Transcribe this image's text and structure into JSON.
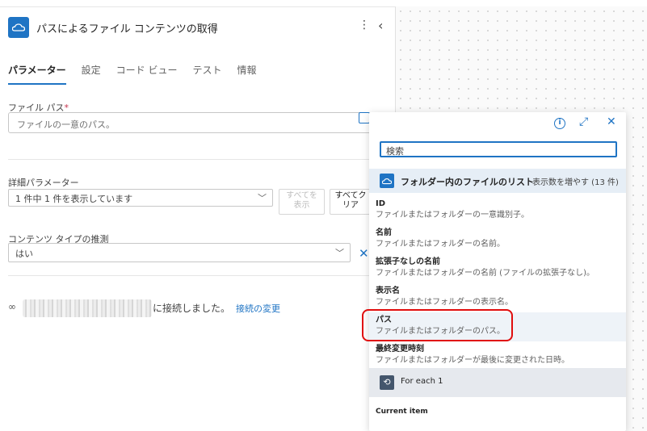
{
  "panel": {
    "title": "パスによるファイル コンテンツの取得",
    "tabs": [
      "パラメーター",
      "設定",
      "コード ビュー",
      "テスト",
      "情報"
    ],
    "file_path": {
      "label": "ファイル パス",
      "required_mark": "*",
      "placeholder": "ファイルの一意のパス。"
    },
    "advanced": {
      "label": "詳細パラメーター",
      "selected": "1 件中 1 件を表示しています",
      "show_all_label": "すべてを\n表示",
      "clear_all_label": "すべてク\nリア"
    },
    "content_type": {
      "label": "コンテンツ タイプの推測",
      "value": "はい"
    },
    "connection": {
      "text": "に接続しました。",
      "change_link": "接続の変更"
    }
  },
  "popup": {
    "search_placeholder": "検索",
    "section": {
      "title": "フォルダー内のファイルのリスト",
      "more": "表示数を増やす (13 件)"
    },
    "items": [
      {
        "title": "ID",
        "desc": "ファイルまたはフォルダーの一意識別子。"
      },
      {
        "title": "名前",
        "desc": "ファイルまたはフォルダーの名前。"
      },
      {
        "title": "拡張子なしの名前",
        "desc": "ファイルまたはフォルダーの名前 (ファイルの拡張子なし)。"
      },
      {
        "title": "表示名",
        "desc": "ファイルまたはフォルダーの表示名。"
      },
      {
        "title": "パス",
        "desc": "ファイルまたはフォルダーのパス。"
      },
      {
        "title": "最終変更時刻",
        "desc": "ファイルまたはフォルダーが最後に変更された日時。"
      }
    ],
    "foreach": {
      "title": "For each 1"
    },
    "current_item": "Current item"
  },
  "colors": {
    "accent": "#1f74c4",
    "highlight_box": "#e00d0d",
    "section_bg": "#e6eef6"
  }
}
